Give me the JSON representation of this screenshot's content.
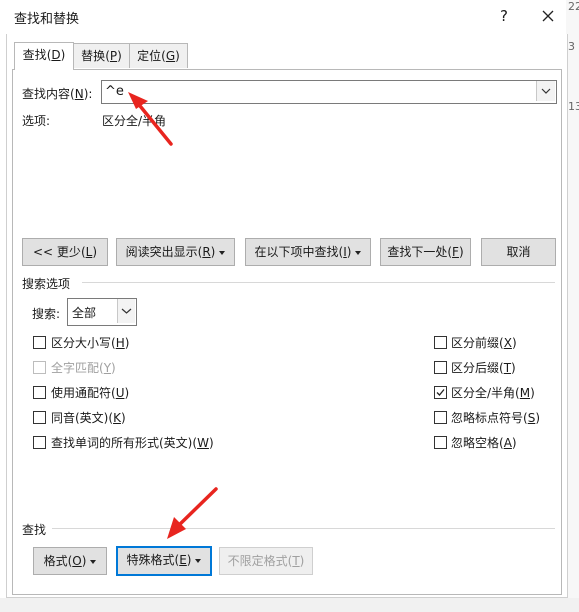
{
  "window": {
    "title": "查找和替换",
    "help": "?",
    "close": "✕"
  },
  "edge_fragments": [
    "22",
    "3",
    "13"
  ],
  "tabs": [
    {
      "label": "查找",
      "key": "D"
    },
    {
      "label": "替换",
      "key": "P"
    },
    {
      "label": "定位",
      "key": "G"
    }
  ],
  "find": {
    "label": "查找内容",
    "key": "N",
    "value": "^e"
  },
  "options_summary": {
    "label": "选项:",
    "value": "区分全/半角"
  },
  "buttons": {
    "less": {
      "label": "<< 更少",
      "key": "L"
    },
    "reading_highlight": {
      "label": "阅读突出显示",
      "key": "R"
    },
    "find_in": {
      "label": "在以下项中查找",
      "key": "I"
    },
    "find_next": {
      "label": "查找下一处",
      "key": "F"
    },
    "cancel": "取消"
  },
  "search_options": {
    "title": "搜索选项",
    "search_label": "搜索",
    "search_key": "C",
    "search_value": "全部",
    "left": [
      {
        "label": "区分大小写",
        "key": "H",
        "checked": false,
        "disabled": false
      },
      {
        "label": "全字匹配",
        "key": "Y",
        "checked": false,
        "disabled": true
      },
      {
        "label": "使用通配符",
        "key": "U",
        "checked": false,
        "disabled": false
      },
      {
        "label": "同音(英文)",
        "key": "K",
        "checked": false,
        "disabled": false
      },
      {
        "label": "查找单词的所有形式(英文)",
        "key": "W",
        "checked": false,
        "disabled": false
      }
    ],
    "right": [
      {
        "label": "区分前缀",
        "key": "X",
        "checked": false,
        "disabled": false
      },
      {
        "label": "区分后缀",
        "key": "T",
        "checked": false,
        "disabled": false
      },
      {
        "label": "区分全/半角",
        "key": "M",
        "checked": true,
        "disabled": false
      },
      {
        "label": "忽略标点符号",
        "key": "S",
        "checked": false,
        "disabled": false
      },
      {
        "label": "忽略空格",
        "key": "A",
        "checked": false,
        "disabled": false
      }
    ]
  },
  "find_section": {
    "title": "查找",
    "format": {
      "label": "格式",
      "key": "O"
    },
    "special": {
      "label": "特殊格式",
      "key": "E"
    },
    "no_format": {
      "label": "不限定格式",
      "key": "T"
    }
  },
  "colors": {
    "accent": "#0078d7",
    "arrow": "#e8251f"
  }
}
